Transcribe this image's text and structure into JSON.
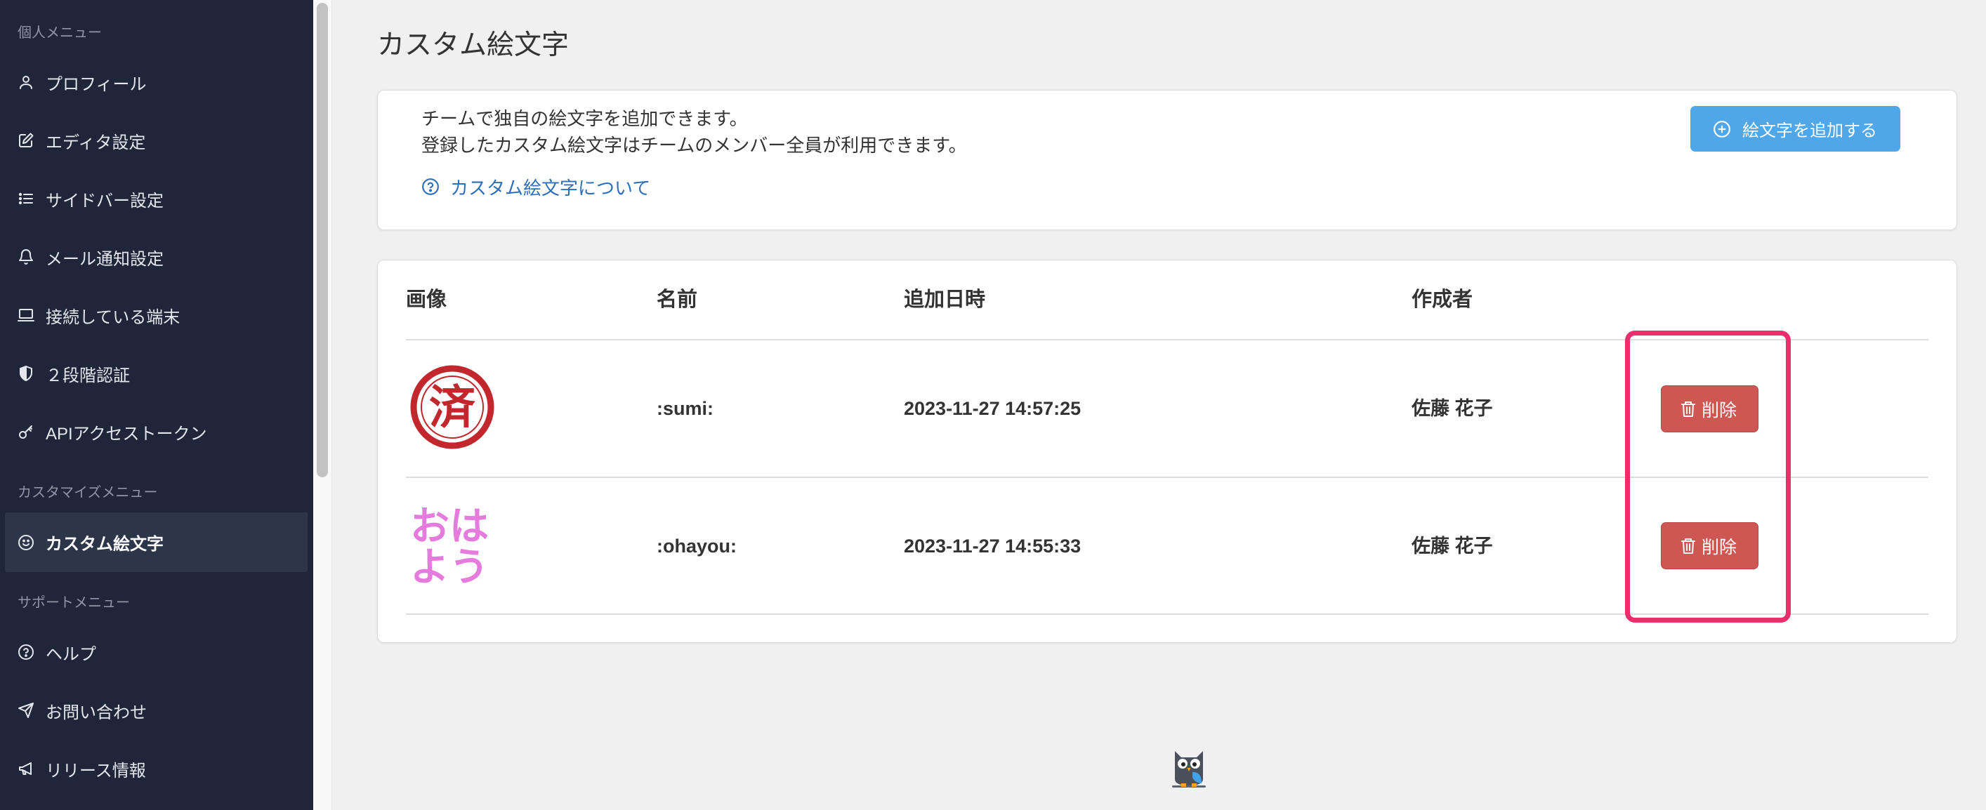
{
  "sidebar": {
    "personal_label": "個人メニュー",
    "personal_items": [
      {
        "label": "プロフィール",
        "icon": "user-icon"
      },
      {
        "label": "エディタ設定",
        "icon": "edit-icon"
      },
      {
        "label": "サイドバー設定",
        "icon": "list-icon"
      },
      {
        "label": "メール通知設定",
        "icon": "bell-icon"
      },
      {
        "label": "接続している端末",
        "icon": "laptop-icon"
      },
      {
        "label": "２段階認証",
        "icon": "shield-icon"
      },
      {
        "label": "APIアクセストークン",
        "icon": "key-icon"
      }
    ],
    "customize_label": "カスタマイズメニュー",
    "customize_items": [
      {
        "label": "カスタム絵文字",
        "icon": "smile-icon",
        "active": true
      }
    ],
    "support_label": "サポートメニュー",
    "support_items": [
      {
        "label": "ヘルプ",
        "icon": "question-circle-icon"
      },
      {
        "label": "お問い合わせ",
        "icon": "paper-plane-icon"
      },
      {
        "label": "リリース情報",
        "icon": "megaphone-icon"
      }
    ]
  },
  "main": {
    "title": "カスタム絵文字",
    "info": {
      "line1": "チームで独自の絵文字を追加できます。",
      "line2": "登録したカスタム絵文字はチームのメンバー全員が利用できます。",
      "help_link": "カスタム絵文字について",
      "add_button": "絵文字を追加する"
    },
    "table": {
      "columns": [
        "画像",
        "名前",
        "追加日時",
        "作成者"
      ],
      "rows": [
        {
          "image_text": [
            "済"
          ],
          "name": ":sumi:",
          "added_at": "2023-11-27 14:57:25",
          "creator": "佐藤 花子",
          "delete_label": "削除"
        },
        {
          "image_text": [
            "おは",
            "よう"
          ],
          "name": ":ohayou:",
          "added_at": "2023-11-27 14:55:33",
          "creator": "佐藤 花子",
          "delete_label": "削除"
        }
      ]
    }
  },
  "colors": {
    "sidebar_bg": "#1f263a",
    "accent_blue": "#4fa6e9",
    "link_blue": "#2f6fb8",
    "danger_red": "#cf5753",
    "highlight_pink": "#ec2f6c",
    "stamp_red": "#c1272d",
    "emoji_pink": "#e57bdc"
  }
}
